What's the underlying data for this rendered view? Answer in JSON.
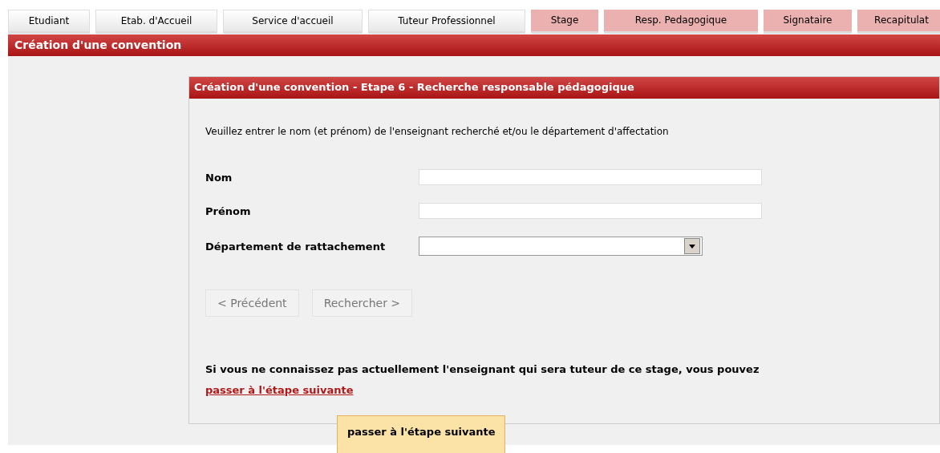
{
  "tabs": [
    {
      "label": "Etudiant",
      "kind": "done"
    },
    {
      "label": "Etab. d'Accueil",
      "kind": "done"
    },
    {
      "label": "Service d'accueil",
      "kind": "done"
    },
    {
      "label": "Tuteur Professionnel",
      "kind": "done"
    },
    {
      "label": "Stage",
      "kind": "todo"
    },
    {
      "label": "Resp. Pedagogique",
      "kind": "todo"
    },
    {
      "label": "Signataire",
      "kind": "todo"
    },
    {
      "label": "Recapitulat",
      "kind": "todo"
    }
  ],
  "page_title": "Création d'une convention",
  "panel": {
    "title": "Création d'une convention - Etape 6 - Recherche responsable pédagogique",
    "intro": "Veuillez entrer le nom (et prénom) de l'enseignant recherché et/ou le département d'affectation",
    "fields": [
      {
        "label": "Nom",
        "kind": "text"
      },
      {
        "label": "Prénom",
        "kind": "text"
      },
      {
        "label": "Département de rattachement",
        "kind": "select"
      }
    ],
    "buttons": [
      "< Précédent",
      "Rechercher >"
    ],
    "note": "Si vous ne connaissez pas actuellement l'enseignant qui sera tuteur de ce stage, vous pouvez",
    "link": "passer à l'étape suivante"
  },
  "tooltip": "passer à l'étape suivante"
}
